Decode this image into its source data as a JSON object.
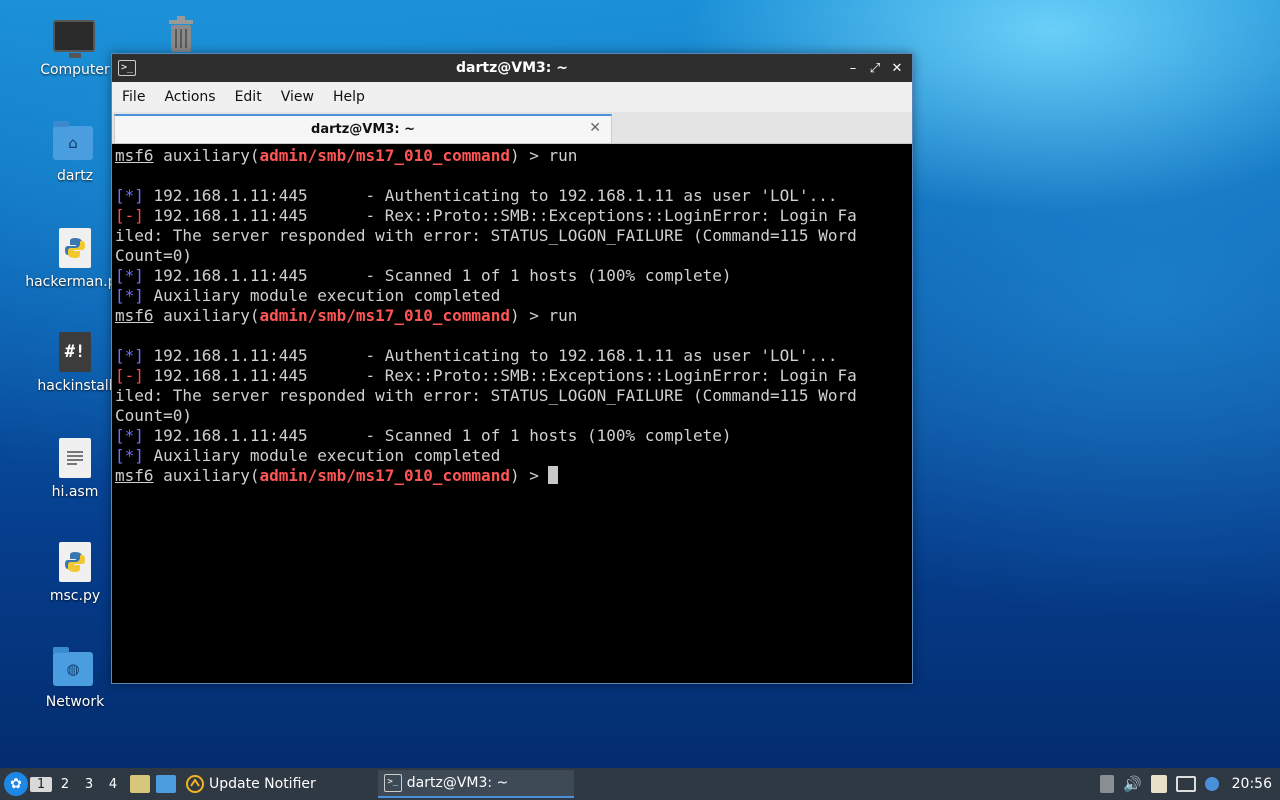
{
  "desktop": {
    "icons": [
      {
        "label": "Computer",
        "icon": "computer-icon"
      },
      {
        "label": "",
        "icon": "trash-icon"
      },
      {
        "label": "dartz",
        "icon": "home-folder-icon"
      },
      {
        "label": "hackerman.py",
        "icon": "python-file-icon"
      },
      {
        "label": "hackinstall",
        "icon": "shell-script-icon"
      },
      {
        "label": "hi.asm",
        "icon": "text-file-icon"
      },
      {
        "label": "msc.py",
        "icon": "python-file-icon"
      },
      {
        "label": "Network",
        "icon": "network-folder-icon"
      }
    ]
  },
  "window": {
    "title": "dartz@VM3: ~",
    "controls": {
      "minimize": "–",
      "maximize": "⤢",
      "close": "✕"
    },
    "menu": [
      "File",
      "Actions",
      "Edit",
      "View",
      "Help"
    ],
    "tab": {
      "title": "dartz@VM3: ~",
      "close": "✕"
    }
  },
  "terminal": {
    "prompt_prefix": "msf6",
    "prompt_word": "auxiliary(",
    "module": "admin/smb/ms17_010_command",
    "prompt_suffix": ") > ",
    "command": "run",
    "info_tag": "[*]",
    "err_tag": "[-]",
    "auth": " 192.168.1.11:445      - Authenticating to 192.168.1.11 as user 'LOL'...",
    "err1": " 192.168.1.11:445      - Rex::Proto::SMB::Exceptions::LoginError: Login Fa",
    "err2": "iled: The server responded with error: STATUS_LOGON_FAILURE (Command=115 Word",
    "err3": "Count=0)",
    "scanned": " 192.168.1.11:445      - Scanned 1 of 1 hosts (100% complete)",
    "completed": " Auxiliary module execution completed"
  },
  "taskbar": {
    "workspaces": [
      "1",
      "2",
      "3",
      "4"
    ],
    "tasks": [
      {
        "label": "Update Notifier",
        "icon": "update-notifier-icon"
      },
      {
        "label": "dartz@VM3: ~",
        "icon": "terminal-icon"
      }
    ],
    "clock": "20:56"
  },
  "colors": {
    "accent": "#4a90d9",
    "module_red": "#ff5555",
    "info_blue": "#6f6fff",
    "taskbar": "#2f3944"
  }
}
